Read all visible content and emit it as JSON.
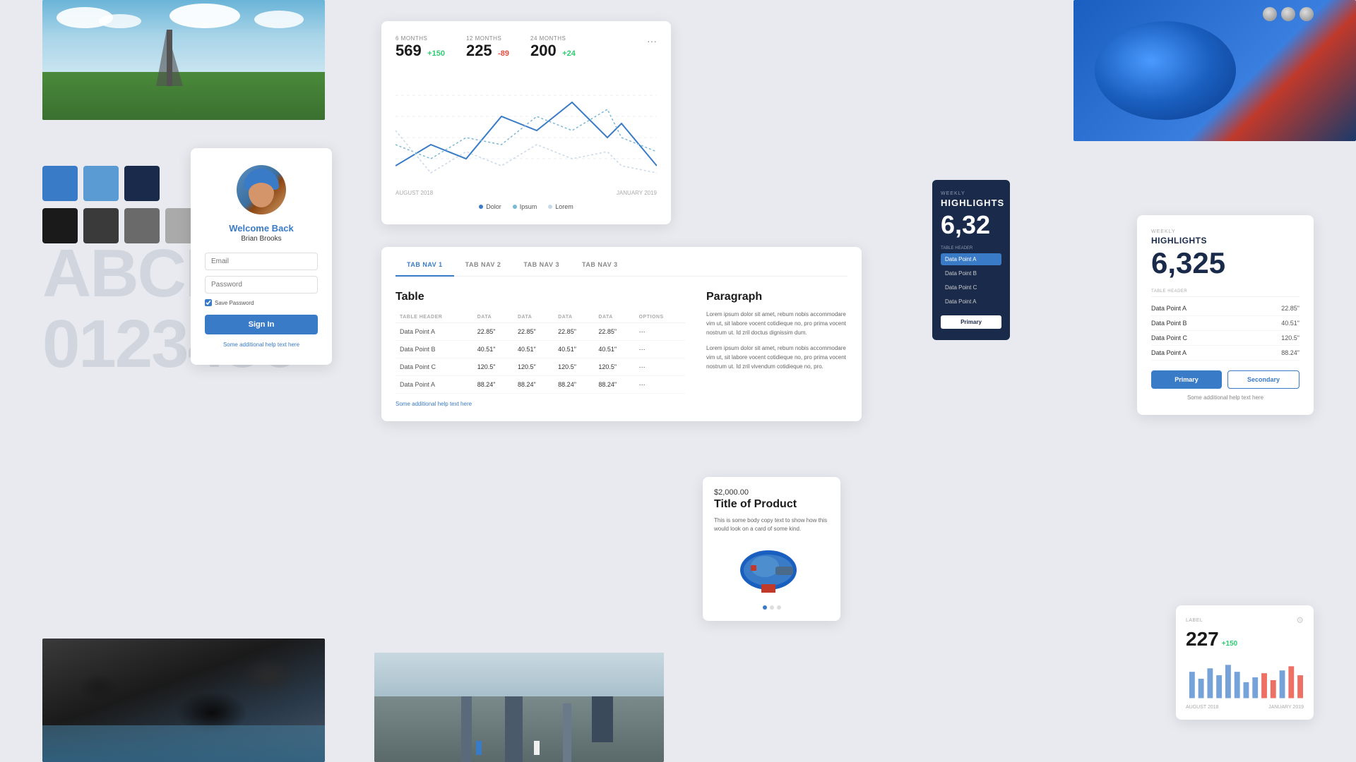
{
  "colors": {
    "primary": "#3a7bc8",
    "swatch1": "#3a7bc8",
    "swatch2": "#5a9bd4",
    "swatch3": "#1a2a4a",
    "swatch4": "#1a1a1a",
    "swatch5": "#3a3a3a",
    "swatch6": "#6a6a6a",
    "swatch7": "#aaaaaa",
    "swatch8": "#cccccc"
  },
  "typography": {
    "letters": "ABCDEF",
    "numbers": "0123456"
  },
  "login": {
    "welcome_title": "Welcome Back",
    "welcome_name": "Brian Brooks",
    "email_placeholder": "Email",
    "password_placeholder": "Password",
    "save_password_label": "Save Password",
    "sign_in_label": "Sign In",
    "help_text": "Some additional help text here"
  },
  "chart": {
    "metrics": [
      {
        "period": "6 MONTHS",
        "value": "569",
        "delta": "+150",
        "positive": true
      },
      {
        "period": "12 MONTHS",
        "value": "225",
        "delta": "-89",
        "positive": false
      },
      {
        "period": "24 MONTHS",
        "value": "200",
        "delta": "+24",
        "positive": true
      }
    ],
    "date_start": "AUGUST 2018",
    "date_end": "JANUARY 2019",
    "legend": [
      {
        "label": "Dolor",
        "color": "#3a7bc8"
      },
      {
        "label": "Ipsum",
        "color": "#7ab8d8"
      },
      {
        "label": "Lorem",
        "color": "#c8d8e8"
      }
    ]
  },
  "table_card": {
    "tabs": [
      "TAB NAV 1",
      "TAB NAV 2",
      "TAB NAV 3",
      "TAB NAV 3"
    ],
    "active_tab": 0,
    "table_title": "Table",
    "columns": [
      "TABLE HEADER",
      "DATA",
      "DATA",
      "DATA",
      "DATA",
      "OPTIONS"
    ],
    "rows": [
      [
        "Data Point A",
        "22.85\"",
        "22.85\"",
        "22.85\"",
        "22.85\""
      ],
      [
        "Data Point B",
        "40.51\"",
        "40.51\"",
        "40.51\"",
        "40.51\""
      ],
      [
        "Data Point C",
        "120.5\"",
        "120.5\"",
        "120.5\"",
        "120.5\""
      ],
      [
        "Data Point A",
        "88.24\"",
        "88.24\"",
        "88.24\"",
        "88.24\""
      ]
    ],
    "help_text": "Some additional help text here",
    "para_title": "Paragraph",
    "para_text1": "Lorem ipsum dolor sit amet, rebum nobis accommodare vim ut, sit labore vocent cotidieque no, pro prima vocent nostrum ut. Id zril doctus dignissim dum.",
    "para_text2": "Lorem ipsum dolor sit amet, rebum nobis accommodare vim ut, sit labore vocent cotidieque no, pro prima vocent nostrum ut. Id zril vivendum cotidieque no, pro."
  },
  "highlights_dark": {
    "label": "WEEKLY",
    "title": "HIGHLIGHTS",
    "number": "6,32",
    "table_header": "TABLE HEADER",
    "rows": [
      "Data Point A",
      "Data Point B",
      "Data Point C",
      "Data Point A"
    ],
    "active_row": 0,
    "button_label": "Primary"
  },
  "highlights_white": {
    "label": "WEEKLY",
    "title": "HIGHLIGHTS",
    "number": "6,325",
    "table_header": "TABLE HEADER",
    "rows": [
      {
        "label": "Data Point A",
        "value": "22.85\""
      },
      {
        "label": "Data Point B",
        "value": "40.51\""
      },
      {
        "label": "Data Point C",
        "value": "120.5\""
      },
      {
        "label": "Data Point A",
        "value": "88.24\""
      }
    ],
    "btn_primary": "Primary",
    "btn_secondary": "Secondary",
    "help_text": "Some additional help text here"
  },
  "product_card": {
    "price": "$2,000.00",
    "title": "Title of Product",
    "description": "This is some body copy text to show how this would look on a card of some kind.",
    "dots": 3,
    "active_dot": 0
  },
  "mini_stat": {
    "label": "LABEL",
    "value": "227",
    "delta": "+150",
    "date_start": "AUGUST 2018",
    "date_end": "JANUARY 2019"
  }
}
